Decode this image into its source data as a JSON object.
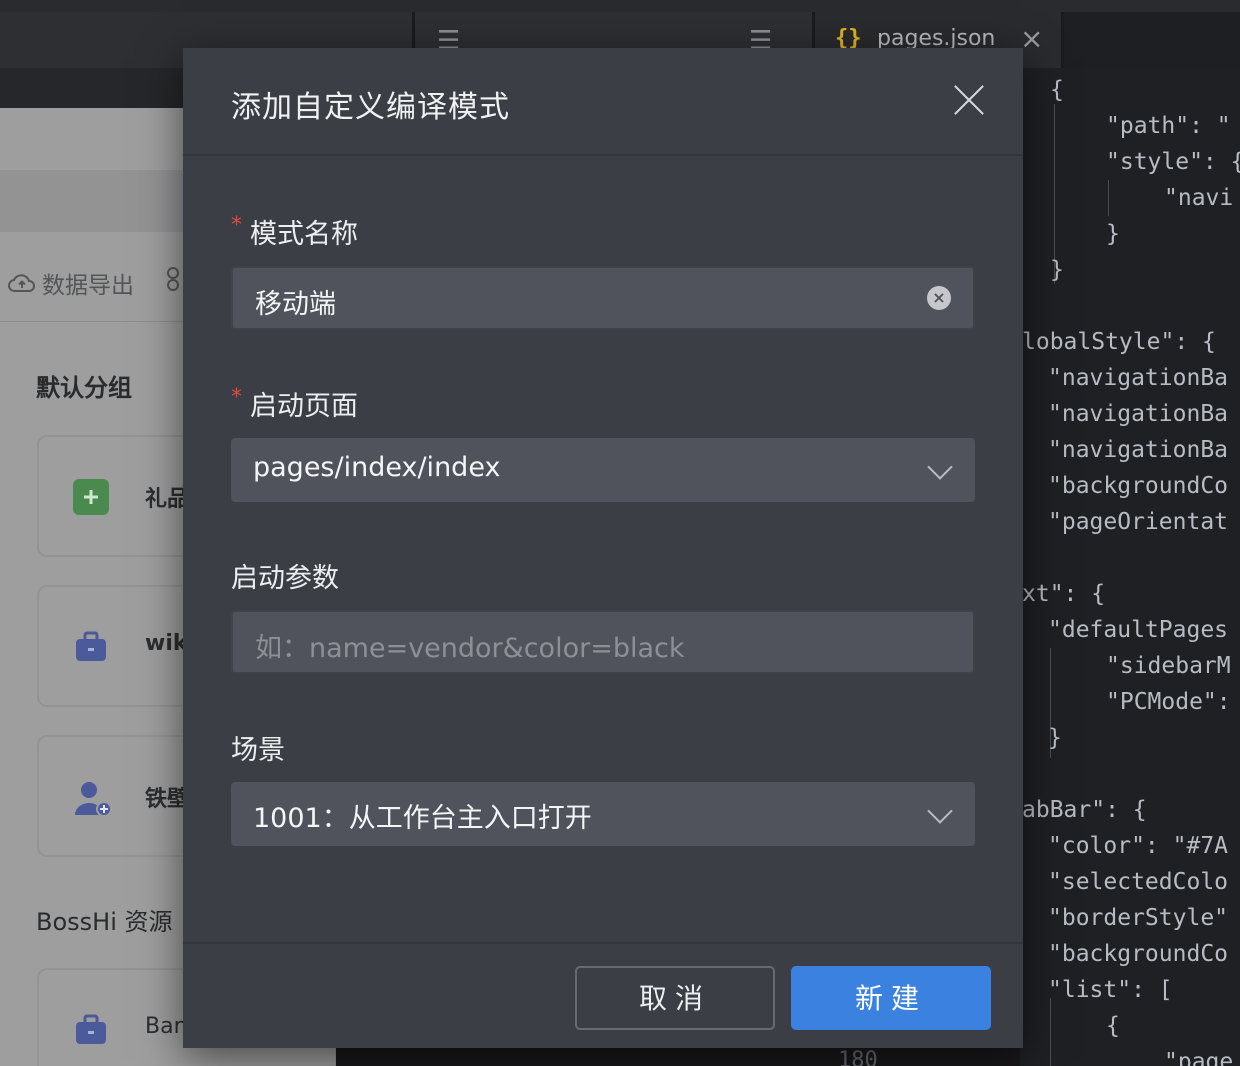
{
  "ide": {
    "json_tab": {
      "icon": "{}",
      "name": "pages.json"
    },
    "line_number": "180",
    "code_lines": [
      "{",
      "\"path\": \"",
      "\"style\": {",
      "\"navi",
      "}",
      "}",
      "lobalStyle\": {",
      "\"navigationBa",
      "\"navigationBa",
      "\"navigationBa",
      "\"backgroundCo",
      "\"pageOrientat",
      "xt\": {",
      "\"defaultPages",
      "\"sidebarM",
      "\"PCMode\":",
      "}",
      "abBar\": {",
      "\"color\": \"#7A",
      "\"selectedColo",
      "\"borderStyle\"",
      "\"backgroundCo",
      "\"list\": [",
      "{",
      "\"page"
    ]
  },
  "left_panel": {
    "export_label": "数据导出",
    "group_default": "默认分组",
    "group_bosshi": "BossHi 资源",
    "cards": [
      "礼品",
      "wiki",
      "铁壁",
      "Ban"
    ]
  },
  "dialog": {
    "title": "添加自定义编译模式",
    "fields": {
      "mode_name": {
        "label": "模式名称",
        "value": "移动端"
      },
      "start_page": {
        "label": "启动页面",
        "value": "pages/index/index"
      },
      "start_params": {
        "label": "启动参数",
        "placeholder": "如：name=vendor&color=black"
      },
      "scene": {
        "label": "场景",
        "value": "1001：从工作台主入口打开"
      }
    },
    "required_mark": "*",
    "buttons": {
      "cancel": "取消",
      "create": "新建"
    }
  },
  "colors": {
    "dialog_bg": "#3b3e45",
    "input_bg": "#50535b",
    "primary": "#3b82e0",
    "required": "#e04a3f"
  }
}
